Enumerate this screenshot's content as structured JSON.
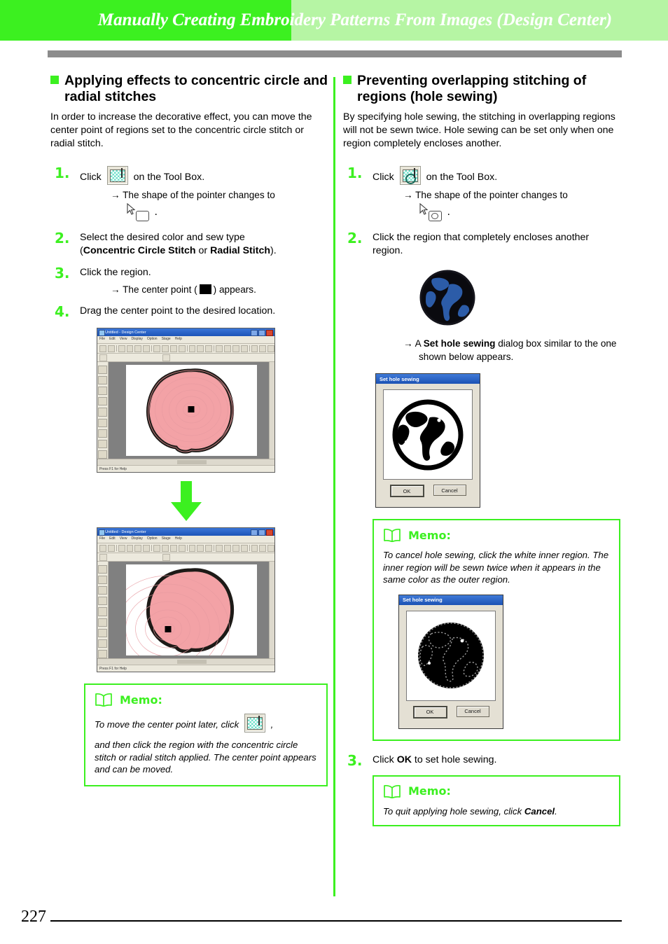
{
  "header": {
    "title": "Manually Creating Embroidery Patterns From Images (Design Center)",
    "band_left_color": "#3cf020",
    "band_right_color": "#b6f5a4",
    "rule_color": "#8c8c8c"
  },
  "footer": {
    "page_number": "227"
  },
  "accent_color": "#3cf020",
  "left_column": {
    "heading": "Applying effects to concentric circle and radial stitches",
    "intro": "In order to increase the decorative effect, you can move the center point of regions set to the concentric circle stitch or radial stitch.",
    "steps": [
      {
        "num": "1.",
        "text_before": "Click",
        "text_after": "on the Tool Box.",
        "result": "→ The shape of the pointer changes to",
        "result_tail": "."
      },
      {
        "num": "2.",
        "text_1": "Select the desired color and sew type",
        "text_2_open": "(",
        "bold_a": "Concentric Circle Stitch",
        "text_or": " or ",
        "bold_b": "Radial Stitch",
        "text_2_close": ")."
      },
      {
        "num": "3.",
        "text": "Click the region.",
        "result_before": "→ The center point (",
        "result_after": ") appears."
      },
      {
        "num": "4.",
        "text": "Drag the center point to the desired location."
      }
    ],
    "screenshot_before": {
      "window_title": "Untitled - Design Center",
      "menus": [
        "File",
        "Edit",
        "View",
        "Display",
        "Option",
        "Stage",
        "Help"
      ],
      "status_text": "Press F1 for Help",
      "center_point_position": "center"
    },
    "screenshot_after": {
      "window_title": "Untitled - Design Center",
      "menus": [
        "File",
        "Edit",
        "View",
        "Display",
        "Option",
        "Stage",
        "Help"
      ],
      "status_text": "Press F1 for Help",
      "center_point_position": "lower-left"
    },
    "memo": {
      "label": "Memo:",
      "line1_before": "To move the center point later, click",
      "line1_after": ",",
      "line2": "and then click the region with the concentric circle stitch or radial stitch applied. The center point appears and can be moved."
    }
  },
  "right_column": {
    "heading": "Preventing overlapping stitching of regions (hole sewing)",
    "intro": "By specifying hole sewing, the stitching in overlapping regions will not be sewn twice. Hole sewing can be set only when one region completely encloses another.",
    "steps": [
      {
        "num": "1.",
        "text_before": "Click",
        "text_after": "on the Tool Box.",
        "result": "→ The shape of the pointer changes to",
        "result_tail": "."
      },
      {
        "num": "2.",
        "text": "Click the region that completely encloses another region.",
        "result_before": "→ A ",
        "result_bold": "Set hole sewing",
        "result_after": " dialog box similar to the one shown below appears."
      },
      {
        "num": "3.",
        "text_before": "Click ",
        "text_bold": "OK",
        "text_after": " to set hole sewing."
      }
    ],
    "dialog_1": {
      "title": "Set hole sewing",
      "ok_label": "OK",
      "cancel_label": "Cancel",
      "image": "globe-black-white"
    },
    "dialog_2": {
      "title": "Set hole sewing",
      "ok_label": "OK",
      "cancel_label": "Cancel",
      "image": "globe-all-black-dotted"
    },
    "memo_1": {
      "label": "Memo:",
      "text": "To cancel hole sewing, click the white inner region. The inner region will be sewn twice when it appears in the same color as the outer region."
    },
    "memo_2": {
      "label": "Memo:",
      "text_before": "To quit applying hole sewing, click ",
      "text_bold": "Cancel",
      "text_after": "."
    }
  }
}
